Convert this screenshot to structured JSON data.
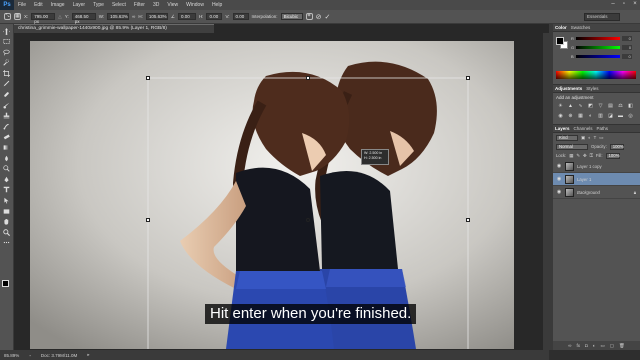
{
  "app": {
    "logo": "Ps"
  },
  "menu": [
    "File",
    "Edit",
    "Image",
    "Layer",
    "Type",
    "Select",
    "Filter",
    "3D",
    "View",
    "Window",
    "Help"
  ],
  "options": {
    "x_label": "X:",
    "x_value": "795.00 px",
    "y_label": "Y:",
    "y_value": "468.50 px",
    "w_label": "W:",
    "w_value": "105.63%",
    "h_label": "H:",
    "h_value": "105.63%",
    "angle_value": "0.00",
    "hskew_label": "H:",
    "hskew_value": "0.00",
    "vskew_label": "V:",
    "vskew_value": "0.00",
    "interpolation_label": "Interpolation:",
    "interpolation_value": "Bicubic",
    "workspace": "Essentials"
  },
  "document": {
    "tab_title": "christina_grimmie-wallpaper-1440x900.jpg @ 85.9% (Layer 1, RGB/8)",
    "tooltip_line1": "W: 2.500 in",
    "tooltip_line2": "H: 2.500 in"
  },
  "subtitle": "Hit enter when you're finished.",
  "status": {
    "zoom": "85.89%",
    "doc": "Doc: 3.79M/11.0M"
  },
  "panels": {
    "color_tabs": [
      "Color",
      "Swatches"
    ],
    "sliders": [
      {
        "label": "R",
        "value": "0",
        "color": "#ff0000"
      },
      {
        "label": "G",
        "value": "0",
        "color": "#00ff00"
      },
      {
        "label": "B",
        "value": "0",
        "color": "#0000ff"
      }
    ],
    "adj_tabs": [
      "Adjustments",
      "Styles"
    ],
    "adj_title": "Add an adjustment",
    "layers_tabs": [
      "Layers",
      "Channels",
      "Paths"
    ],
    "kind_label": "Kind",
    "blend_mode": "Normal",
    "opacity_label": "Opacity:",
    "opacity_value": "100%",
    "lock_label": "Lock:",
    "fill_label": "Fill:",
    "fill_value": "100%",
    "layers": [
      {
        "name": "Layer 1 copy",
        "selected": false,
        "italic": false
      },
      {
        "name": "Layer 1",
        "selected": true,
        "italic": false
      },
      {
        "name": "Background",
        "selected": false,
        "italic": true
      }
    ]
  },
  "colors": {
    "accent": "#6d8bb0",
    "chrome": "#535353"
  }
}
